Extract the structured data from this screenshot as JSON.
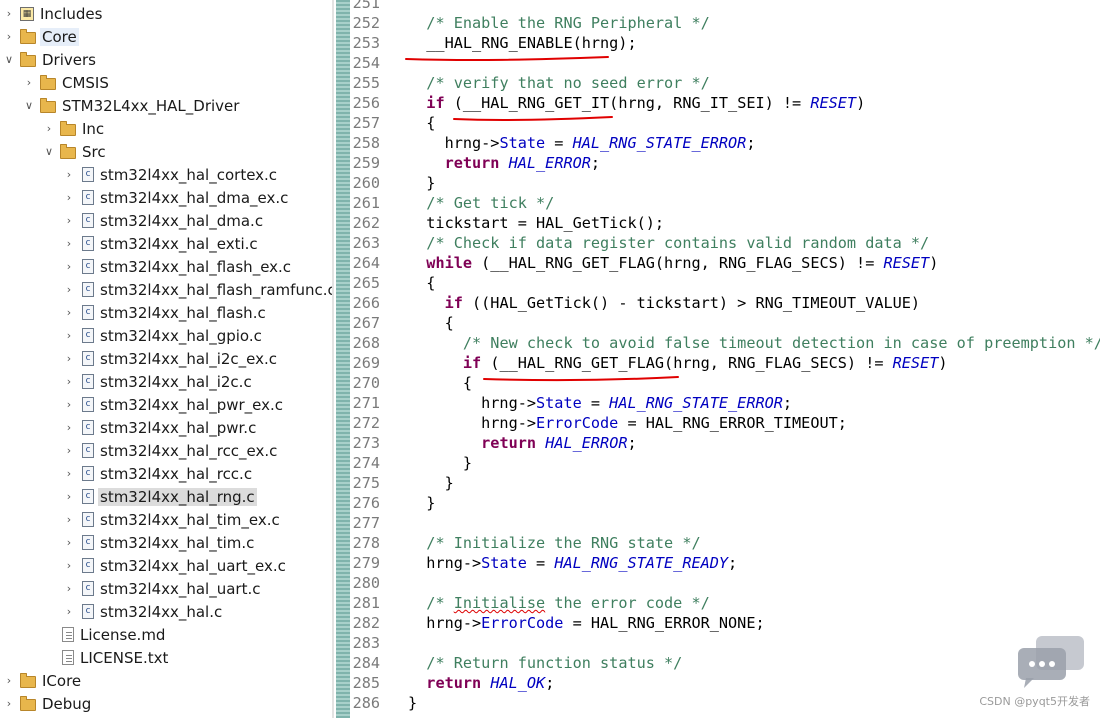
{
  "tree": [
    {
      "label": "Includes",
      "depth": 0,
      "arrow": "right",
      "icon": "includes-icon"
    },
    {
      "label": "Core",
      "depth": 0,
      "arrow": "right",
      "icon": "folder-icon",
      "selected": true
    },
    {
      "label": "Drivers",
      "depth": 0,
      "arrow": "down",
      "icon": "folder-icon"
    },
    {
      "label": "CMSIS",
      "depth": 1,
      "arrow": "right",
      "icon": "folder-icon"
    },
    {
      "label": "STM32L4xx_HAL_Driver",
      "depth": 1,
      "arrow": "down",
      "icon": "folder-icon"
    },
    {
      "label": "Inc",
      "depth": 2,
      "arrow": "right",
      "icon": "folder-icon"
    },
    {
      "label": "Src",
      "depth": 2,
      "arrow": "down",
      "icon": "folder-icon"
    },
    {
      "label": "stm32l4xx_hal_cortex.c",
      "depth": 3,
      "arrow": "right",
      "icon": "c-file-icon"
    },
    {
      "label": "stm32l4xx_hal_dma_ex.c",
      "depth": 3,
      "arrow": "right",
      "icon": "c-file-icon"
    },
    {
      "label": "stm32l4xx_hal_dma.c",
      "depth": 3,
      "arrow": "right",
      "icon": "c-file-icon"
    },
    {
      "label": "stm32l4xx_hal_exti.c",
      "depth": 3,
      "arrow": "right",
      "icon": "c-file-icon"
    },
    {
      "label": "stm32l4xx_hal_flash_ex.c",
      "depth": 3,
      "arrow": "right",
      "icon": "c-file-icon"
    },
    {
      "label": "stm32l4xx_hal_flash_ramfunc.c",
      "depth": 3,
      "arrow": "right",
      "icon": "c-file-icon"
    },
    {
      "label": "stm32l4xx_hal_flash.c",
      "depth": 3,
      "arrow": "right",
      "icon": "c-file-icon"
    },
    {
      "label": "stm32l4xx_hal_gpio.c",
      "depth": 3,
      "arrow": "right",
      "icon": "c-file-icon"
    },
    {
      "label": "stm32l4xx_hal_i2c_ex.c",
      "depth": 3,
      "arrow": "right",
      "icon": "c-file-icon"
    },
    {
      "label": "stm32l4xx_hal_i2c.c",
      "depth": 3,
      "arrow": "right",
      "icon": "c-file-icon"
    },
    {
      "label": "stm32l4xx_hal_pwr_ex.c",
      "depth": 3,
      "arrow": "right",
      "icon": "c-file-icon"
    },
    {
      "label": "stm32l4xx_hal_pwr.c",
      "depth": 3,
      "arrow": "right",
      "icon": "c-file-icon"
    },
    {
      "label": "stm32l4xx_hal_rcc_ex.c",
      "depth": 3,
      "arrow": "right",
      "icon": "c-file-icon"
    },
    {
      "label": "stm32l4xx_hal_rcc.c",
      "depth": 3,
      "arrow": "right",
      "icon": "c-file-icon"
    },
    {
      "label": "stm32l4xx_hal_rng.c",
      "depth": 3,
      "arrow": "right",
      "icon": "c-file-icon",
      "selected": true
    },
    {
      "label": "stm32l4xx_hal_tim_ex.c",
      "depth": 3,
      "arrow": "right",
      "icon": "c-file-icon"
    },
    {
      "label": "stm32l4xx_hal_tim.c",
      "depth": 3,
      "arrow": "right",
      "icon": "c-file-icon"
    },
    {
      "label": "stm32l4xx_hal_uart_ex.c",
      "depth": 3,
      "arrow": "right",
      "icon": "c-file-icon"
    },
    {
      "label": "stm32l4xx_hal_uart.c",
      "depth": 3,
      "arrow": "right",
      "icon": "c-file-icon"
    },
    {
      "label": "stm32l4xx_hal.c",
      "depth": 3,
      "arrow": "right",
      "icon": "c-file-icon"
    },
    {
      "label": "License.md",
      "depth": 2,
      "arrow": "none",
      "icon": "text-file-icon"
    },
    {
      "label": "LICENSE.txt",
      "depth": 2,
      "arrow": "none",
      "icon": "text-file-icon"
    },
    {
      "label": "ICore",
      "depth": 0,
      "arrow": "right",
      "icon": "folder-icon"
    },
    {
      "label": "Debug",
      "depth": 0,
      "arrow": "right",
      "icon": "folder-icon"
    }
  ],
  "code": {
    "first_line": 251,
    "lines": [
      [],
      [
        [
          "  ",
          ""
        ],
        [
          "/* Enable the RNG Peripheral */",
          "cmt"
        ]
      ],
      [
        [
          "  __HAL_RNG_ENABLE(hrng);",
          ""
        ]
      ],
      [],
      [
        [
          "  ",
          ""
        ],
        [
          "/* verify that no seed error */",
          "cmt"
        ]
      ],
      [
        [
          "  ",
          ""
        ],
        [
          "if",
          "kw"
        ],
        [
          " (__HAL_RNG_GET_IT(hrng, RNG_IT_SEI) != ",
          ""
        ],
        [
          "RESET",
          "cst"
        ],
        [
          ")",
          ""
        ]
      ],
      [
        [
          "  {",
          ""
        ]
      ],
      [
        [
          "    hrng->",
          ""
        ],
        [
          "State",
          "fld"
        ],
        [
          " = ",
          ""
        ],
        [
          "HAL_RNG_STATE_ERROR",
          "cst"
        ],
        [
          ";",
          ""
        ]
      ],
      [
        [
          "    ",
          ""
        ],
        [
          "return",
          "kw"
        ],
        [
          " ",
          ""
        ],
        [
          "HAL_ERROR",
          "cst"
        ],
        [
          ";",
          ""
        ]
      ],
      [
        [
          "  }",
          ""
        ]
      ],
      [
        [
          "  ",
          ""
        ],
        [
          "/* Get tick */",
          "cmt"
        ]
      ],
      [
        [
          "  tickstart = HAL_GetTick();",
          ""
        ]
      ],
      [
        [
          "  ",
          ""
        ],
        [
          "/* Check if data register contains valid random data */",
          "cmt"
        ]
      ],
      [
        [
          "  ",
          ""
        ],
        [
          "while",
          "kw"
        ],
        [
          " (__HAL_RNG_GET_FLAG(hrng, RNG_FLAG_SECS) != ",
          ""
        ],
        [
          "RESET",
          "cst"
        ],
        [
          ")",
          ""
        ]
      ],
      [
        [
          "  {",
          ""
        ]
      ],
      [
        [
          "    ",
          ""
        ],
        [
          "if",
          "kw"
        ],
        [
          " ((HAL_GetTick() - tickstart) > RNG_TIMEOUT_VALUE)",
          ""
        ]
      ],
      [
        [
          "    {",
          ""
        ]
      ],
      [
        [
          "      ",
          ""
        ],
        [
          "/* New check to avoid false timeout detection in case of preemption */",
          "cmt"
        ]
      ],
      [
        [
          "      ",
          ""
        ],
        [
          "if",
          "kw"
        ],
        [
          " (__HAL_RNG_GET_FLAG(hrng, RNG_FLAG_SECS) != ",
          ""
        ],
        [
          "RESET",
          "cst"
        ],
        [
          ")",
          ""
        ]
      ],
      [
        [
          "      {",
          ""
        ]
      ],
      [
        [
          "        hrng->",
          ""
        ],
        [
          "State",
          "fld"
        ],
        [
          " = ",
          ""
        ],
        [
          "HAL_RNG_STATE_ERROR",
          "cst"
        ],
        [
          ";",
          ""
        ]
      ],
      [
        [
          "        hrng->",
          ""
        ],
        [
          "ErrorCode",
          "fld"
        ],
        [
          " = HAL_RNG_ERROR_TIMEOUT;",
          ""
        ]
      ],
      [
        [
          "        ",
          ""
        ],
        [
          "return",
          "kw"
        ],
        [
          " ",
          ""
        ],
        [
          "HAL_ERROR",
          "cst"
        ],
        [
          ";",
          ""
        ]
      ],
      [
        [
          "      }",
          ""
        ]
      ],
      [
        [
          "    }",
          ""
        ]
      ],
      [
        [
          "  }",
          ""
        ]
      ],
      [],
      [
        [
          "  ",
          ""
        ],
        [
          "/* Initialize the RNG state */",
          "cmt"
        ]
      ],
      [
        [
          "  hrng->",
          ""
        ],
        [
          "State",
          "fld"
        ],
        [
          " = ",
          ""
        ],
        [
          "HAL_RNG_STATE_READY",
          "cst"
        ],
        [
          ";",
          ""
        ]
      ],
      [],
      [
        [
          "  ",
          ""
        ],
        [
          "/* ",
          "cmt"
        ],
        [
          "Initialise",
          "cmt squig"
        ],
        [
          " the error code */",
          "cmt"
        ]
      ],
      [
        [
          "  hrng->",
          ""
        ],
        [
          "ErrorCode",
          "fld"
        ],
        [
          " = HAL_RNG_ERROR_NONE;",
          ""
        ]
      ],
      [],
      [
        [
          "  ",
          ""
        ],
        [
          "/* Return function status */",
          "cmt"
        ]
      ],
      [
        [
          "  ",
          ""
        ],
        [
          "return",
          "kw"
        ],
        [
          " ",
          ""
        ],
        [
          "HAL_OK",
          "cst"
        ],
        [
          ";",
          ""
        ]
      ],
      [
        [
          "}",
          ""
        ]
      ]
    ]
  },
  "watermark": "CSDN @pyqt5开发者",
  "colors": {
    "comment": "#3f7f5f",
    "keyword": "#7f0055",
    "field": "#0000c0",
    "annotation": "#e00000"
  }
}
